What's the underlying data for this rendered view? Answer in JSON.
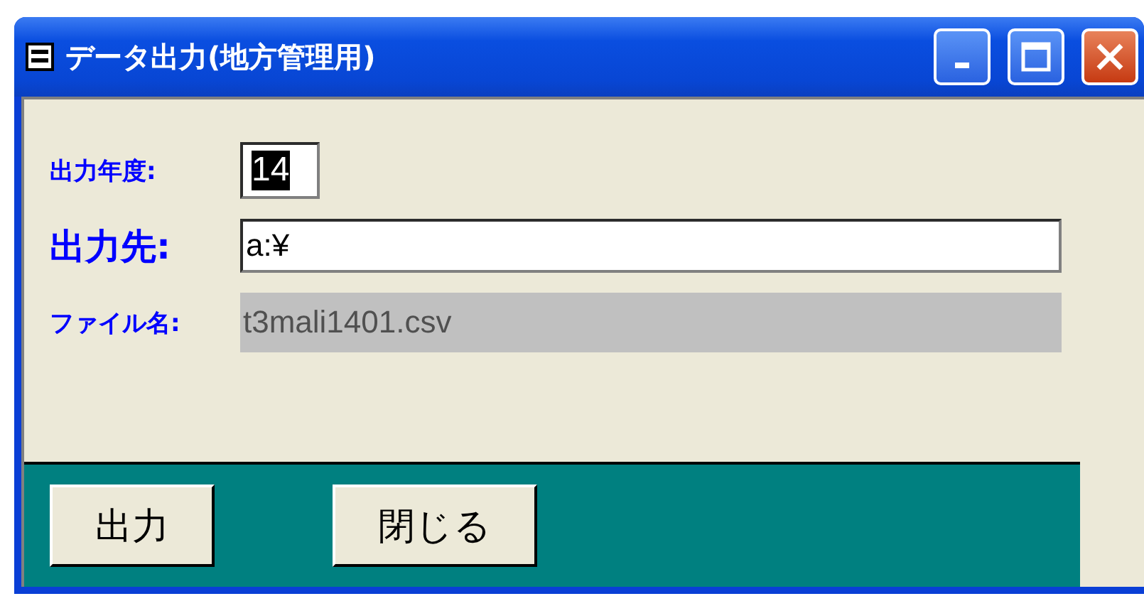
{
  "window": {
    "title": "データ出力(地方管理用)"
  },
  "fields": [
    {
      "kind": "year",
      "label": "出力年度:",
      "value": "14",
      "text_selected": true
    },
    {
      "kind": "path",
      "label": "出力先:",
      "value": "a:¥"
    },
    {
      "kind": "filename",
      "label": "ファイル名:",
      "value": "t3mali1401.csv"
    }
  ],
  "buttons": [
    "出力",
    "閉じる"
  ]
}
